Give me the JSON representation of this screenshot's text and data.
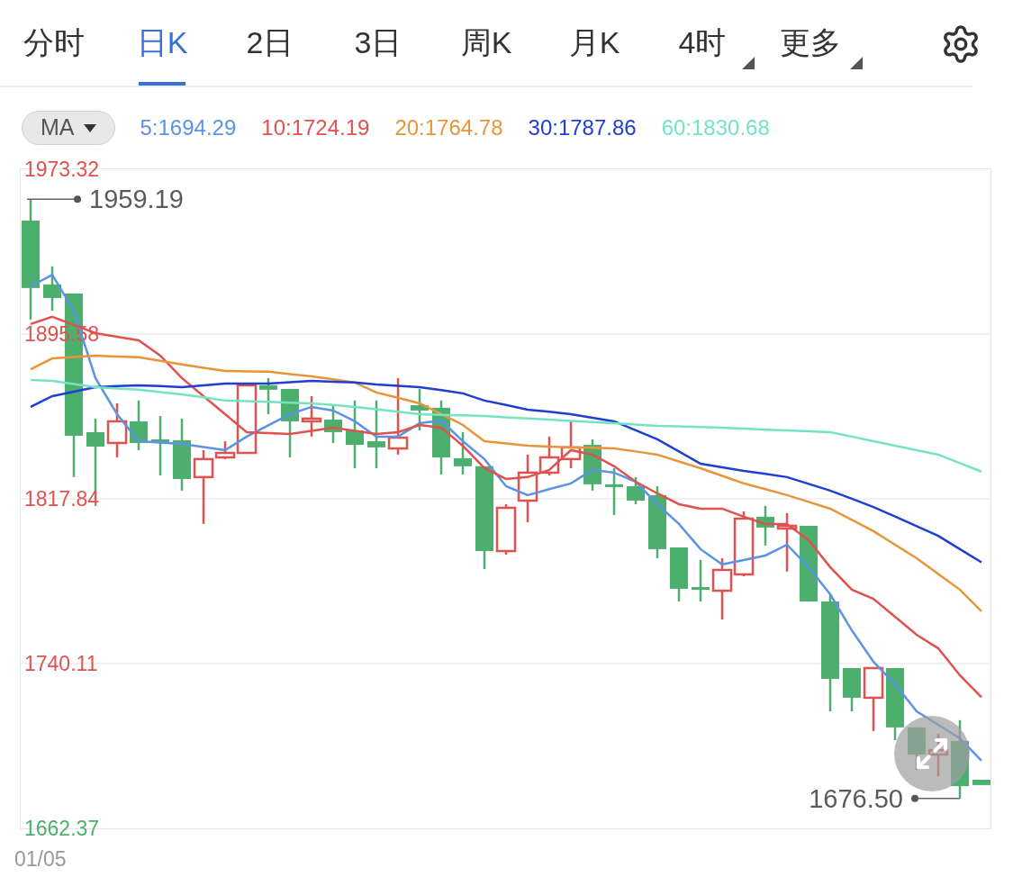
{
  "tabs": [
    {
      "label": "分时",
      "selected": false,
      "kind": "plain"
    },
    {
      "label": "日K",
      "selected": true,
      "kind": "plain"
    },
    {
      "label": "2日",
      "selected": false,
      "kind": "plain"
    },
    {
      "label": "3日",
      "selected": false,
      "kind": "plain"
    },
    {
      "label": "周K",
      "selected": false,
      "kind": "plain"
    },
    {
      "label": "月K",
      "selected": false,
      "kind": "plain"
    },
    {
      "label": "4时",
      "selected": false,
      "kind": "dropdown"
    },
    {
      "label": "更多",
      "selected": false,
      "kind": "dropdown"
    }
  ],
  "indicator": {
    "label": "MA"
  },
  "ma_legend": [
    {
      "label": "5:1694.29",
      "color": "#5b93e6"
    },
    {
      "label": "10:1724.19",
      "color": "#e0524f"
    },
    {
      "label": "20:1764.78",
      "color": "#e8953a"
    },
    {
      "label": "30:1787.86",
      "color": "#1e3fd0"
    },
    {
      "label": "60:1830.68",
      "color": "#74e3c4"
    }
  ],
  "chart": {
    "chart_data": {
      "type": "line",
      "ylim": [
        1662.37,
        1973.32
      ],
      "grid": true,
      "yticks": [
        1973.32,
        1895.58,
        1817.84,
        1740.11,
        1662.37
      ],
      "series": [
        {
          "color": "#5b93e6",
          "values": [
            1918.1,
            1923.6,
            1906.6,
            1874.8,
            1857.8,
            1845.0,
            1844.4,
            1843.8,
            1842.3,
            1840.8,
            1847.2,
            1852.5,
            1857.8,
            1861.2,
            1859.5,
            1854.4,
            1847.2,
            1847.2,
            1853.5,
            1854.8,
            1845.0,
            1836.6,
            1823.8,
            1819.6,
            1822.4,
            1825.1,
            1831.5,
            1830.2,
            1825.9,
            1815.3,
            1806.0,
            1794.1,
            1786.9,
            1789.0,
            1791.1,
            1796.2,
            1785.6,
            1772.8,
            1755.8,
            1741.0,
            1730.4,
            1717.6,
            1711.2,
            1704.9,
            1694.3
          ]
        },
        {
          "color": "#e0524f",
          "values": [
            1900.3,
            1903.7,
            1899.9,
            1896.0,
            1894.3,
            1892.6,
            1885.4,
            1874.8,
            1866.3,
            1857.8,
            1849.3,
            1848.9,
            1848.4,
            1849.9,
            1851.4,
            1849.9,
            1848.4,
            1849.3,
            1852.7,
            1851.4,
            1842.9,
            1832.3,
            1827.2,
            1828.1,
            1831.5,
            1840.8,
            1838.7,
            1833.2,
            1825.9,
            1820.4,
            1815.3,
            1813.2,
            1813.2,
            1809.4,
            1806.0,
            1806.0,
            1798.3,
            1785.6,
            1775.0,
            1770.7,
            1762.2,
            1753.7,
            1747.3,
            1734.6,
            1724.2
          ]
        },
        {
          "color": "#e8953a",
          "values": [
            1879.0,
            1884.1,
            1884.8,
            1885.4,
            1885.0,
            1884.6,
            1882.9,
            1881.2,
            1879.7,
            1878.2,
            1878.0,
            1877.8,
            1876.7,
            1875.6,
            1874.2,
            1872.7,
            1868.0,
            1865.5,
            1862.9,
            1857.8,
            1852.7,
            1845.0,
            1844.0,
            1842.9,
            1842.5,
            1842.1,
            1841.9,
            1841.6,
            1840.2,
            1838.7,
            1835.5,
            1832.3,
            1828.7,
            1825.1,
            1822.4,
            1819.6,
            1816.4,
            1813.2,
            1807.9,
            1802.6,
            1796.2,
            1789.8,
            1782.4,
            1775.0,
            1764.8
          ]
        },
        {
          "color": "#1e3fd0",
          "values": [
            1861.2,
            1866.3,
            1868.4,
            1870.5,
            1871.0,
            1871.4,
            1871.0,
            1870.5,
            1871.4,
            1872.2,
            1872.2,
            1872.2,
            1872.9,
            1873.5,
            1873.1,
            1872.7,
            1871.8,
            1871.2,
            1870.5,
            1869.1,
            1867.6,
            1864.2,
            1862.1,
            1859.9,
            1858.9,
            1857.8,
            1856.1,
            1854.4,
            1850.2,
            1845.9,
            1840.2,
            1834.4,
            1832.7,
            1831.0,
            1829.6,
            1828.1,
            1824.9,
            1821.7,
            1817.9,
            1814.0,
            1809.5,
            1804.9,
            1800.4,
            1794.1,
            1787.9
          ]
        },
        {
          "color": "#74e3c4",
          "values": [
            1873.9,
            1873.5,
            1872.0,
            1870.5,
            1869.9,
            1869.3,
            1868.2,
            1867.1,
            1865.7,
            1864.2,
            1863.9,
            1863.6,
            1863.2,
            1862.9,
            1862.1,
            1861.2,
            1860.1,
            1858.9,
            1857.8,
            1857.5,
            1857.2,
            1856.9,
            1856.3,
            1855.8,
            1855.2,
            1854.6,
            1854.1,
            1853.5,
            1852.9,
            1852.3,
            1852.0,
            1851.7,
            1851.4,
            1851.0,
            1850.5,
            1850.1,
            1849.7,
            1849.3,
            1847.2,
            1845.0,
            1842.9,
            1840.8,
            1838.7,
            1834.7,
            1830.7
          ]
        }
      ],
      "annotations": [
        "1959.19",
        "1676.50"
      ]
    },
    "ytick_styles": [
      {
        "color": "#e0524f"
      },
      {
        "color": "#e0524f"
      },
      {
        "color": "#e0524f"
      },
      {
        "color": "#e0524f"
      },
      {
        "color": "#4caf6e"
      }
    ],
    "date_label": "01/05"
  }
}
